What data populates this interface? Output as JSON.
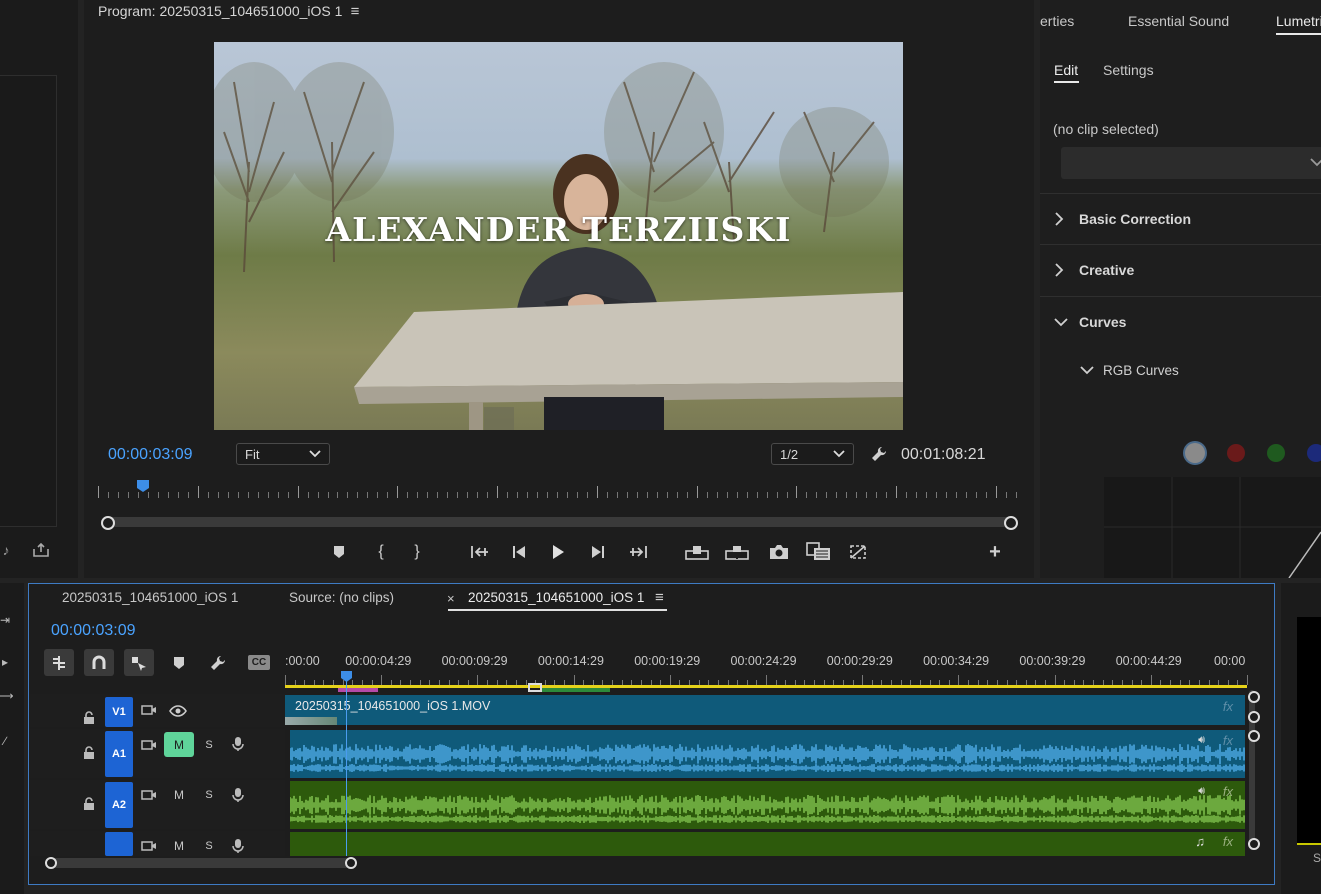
{
  "program_monitor": {
    "title": "Program: 20250315_104651000_iOS 1",
    "overlay_title": "ALEXANDER TERZIISKI",
    "current_timecode": "00:00:03:09",
    "fit_value": "Fit",
    "resolution_value": "1/2",
    "duration_timecode": "00:01:08:21",
    "playhead_fraction": 0.04
  },
  "right_panel": {
    "tabs": [
      "erties",
      "Essential Sound",
      "Lumetri"
    ],
    "active_tab": "Lumetri",
    "subtabs": [
      "Edit",
      "Settings"
    ],
    "active_subtab": "Edit",
    "clip_status": "(no clip selected)",
    "sections": [
      {
        "label": "Basic Correction",
        "expanded": false
      },
      {
        "label": "Creative",
        "expanded": false
      },
      {
        "label": "Curves",
        "expanded": true
      }
    ],
    "subsection": "RGB Curves",
    "curve_channels": [
      "#8a8a8a",
      "#6a1a1a",
      "#1f5a1f",
      "#1c2a7a"
    ]
  },
  "timeline": {
    "tabs": [
      {
        "label": "20250315_104651000_iOS 1",
        "closable": false
      },
      {
        "label": "Source: (no clips)",
        "closable": false
      },
      {
        "label": "20250315_104651000_iOS 1",
        "closable": true
      }
    ],
    "active_tab_index": 2,
    "close_glyph": "×",
    "menu_glyph": "≡",
    "current_timecode": "00:00:03:09",
    "ruler_labels": [
      ":00:00",
      "00:00:04:29",
      "00:00:09:29",
      "00:00:14:29",
      "00:00:19:29",
      "00:00:24:29",
      "00:00:29:29",
      "00:00:34:29",
      "00:00:39:29",
      "00:00:44:29",
      "00:00"
    ],
    "tracks": [
      {
        "id": "V1",
        "type": "video",
        "clip": "20250315_104651000_iOS 1.MOV"
      },
      {
        "id": "A1",
        "type": "audio",
        "m": "M",
        "s": "S",
        "m_active": true
      },
      {
        "id": "A2",
        "type": "audio",
        "m": "M",
        "s": "S",
        "m_active": false
      },
      {
        "id": "",
        "type": "audio",
        "m": "M",
        "s": "S",
        "m_active": false
      }
    ],
    "fx_label": "fx",
    "cc_label": "CC"
  },
  "colors": {
    "accent_blue": "#4aa3ff",
    "video_clip": "#0f5a7a",
    "audio_a1": "#0f5a7a",
    "audio_a2": "#2d5a0c",
    "wave_blue": "#58b7f5",
    "wave_green": "#8fd45a",
    "track_badge": "#1d64d4",
    "mute_active": "#5fd49a"
  }
}
